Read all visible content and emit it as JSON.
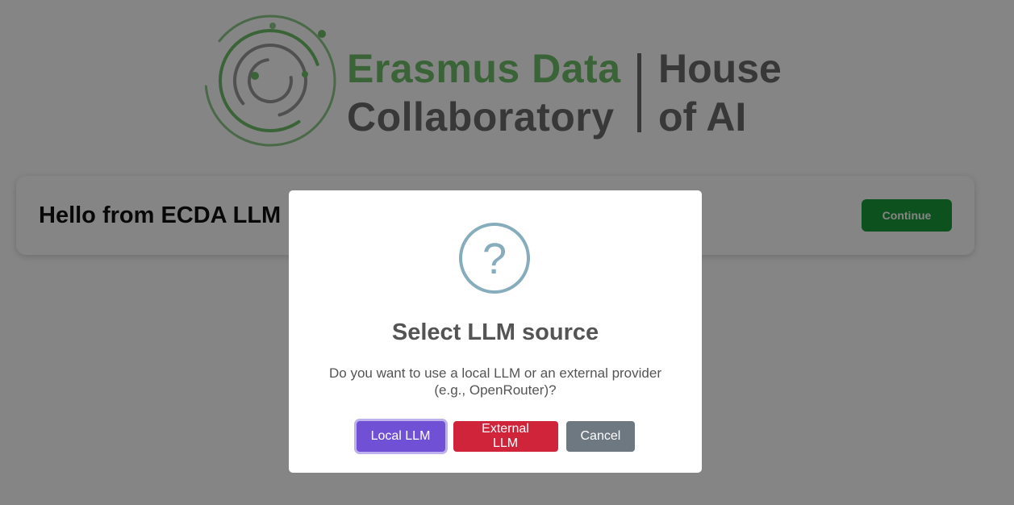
{
  "logo": {
    "brand_line1": "Erasmus Data",
    "brand_line2": "Collaboratory",
    "house_line1": "House",
    "house_line2": "of AI"
  },
  "card": {
    "title": "Hello from ECDA LLM",
    "continue_label": "Continue"
  },
  "modal": {
    "icon_glyph": "?",
    "title": "Select LLM source",
    "text": "Do you want to use a local LLM or an external provider (e.g., OpenRouter)?",
    "buttons": {
      "local": "Local LLM",
      "external": "External LLM",
      "cancel": "Cancel"
    }
  },
  "colors": {
    "brand_green": "#6fbf6a",
    "continue_green": "#1a9b3a",
    "local_purple": "#7051d6",
    "external_red": "#d0243a",
    "cancel_gray": "#6e7881",
    "question_icon": "#87adbd"
  }
}
